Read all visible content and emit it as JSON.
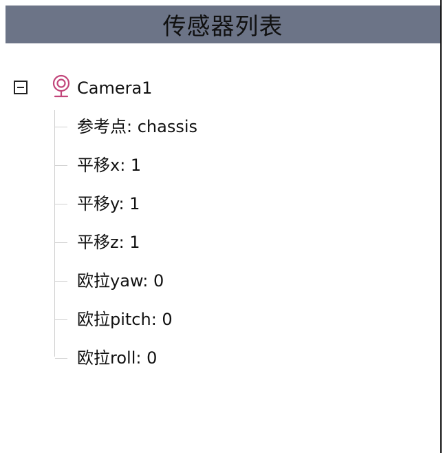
{
  "header": {
    "title": "传感器列表"
  },
  "tree": {
    "node": {
      "label": "Camera1",
      "icon": "camera-icon",
      "expanded": true,
      "icon_color": "#c2457a"
    },
    "children": [
      {
        "label": "参考点: chassis"
      },
      {
        "label": "平移x: 1"
      },
      {
        "label": "平移y: 1"
      },
      {
        "label": "平移z: 1"
      },
      {
        "label": "欧拉yaw: 0"
      },
      {
        "label": "欧拉pitch: 0"
      },
      {
        "label": "欧拉roll: 0"
      }
    ]
  },
  "colors": {
    "header_bg": "#6c7487",
    "tree_line": "#cfcfcf"
  }
}
